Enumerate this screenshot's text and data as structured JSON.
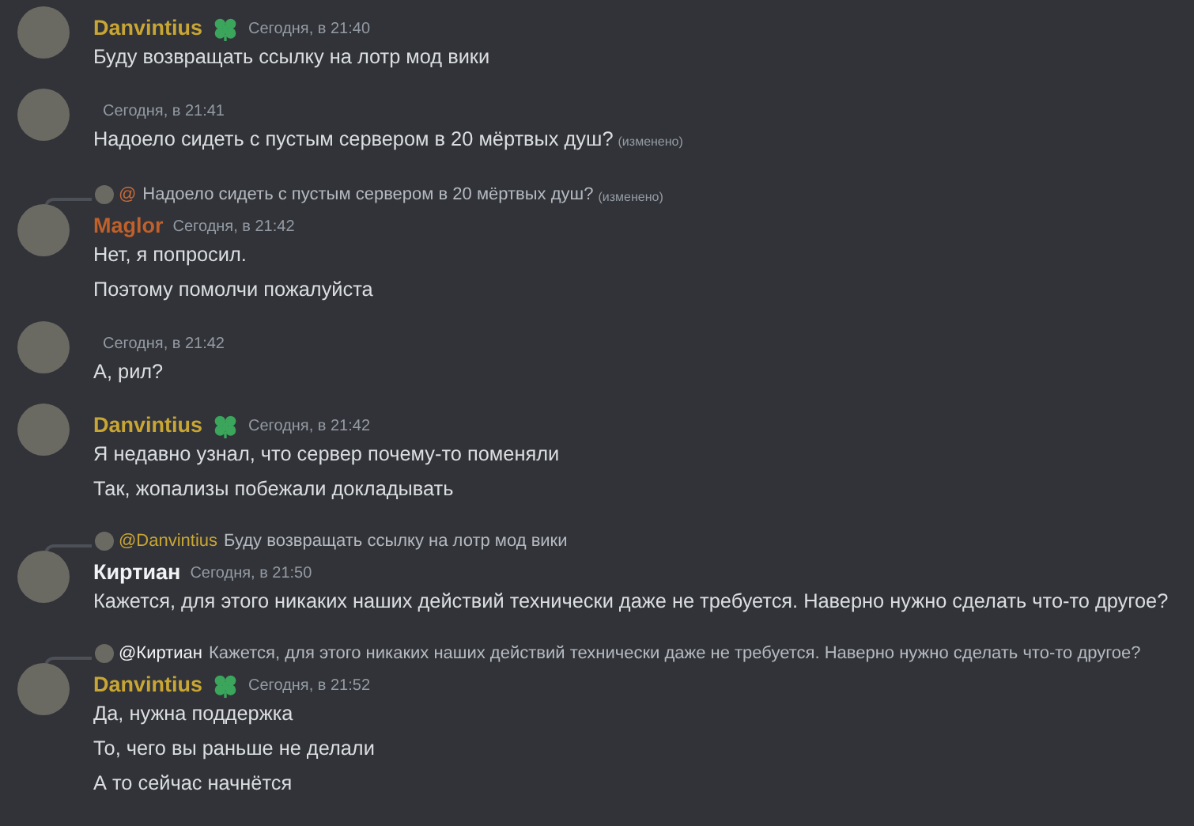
{
  "messages": [
    {
      "author": {
        "name": "Danvintius",
        "color": "#c9a634"
      },
      "badge": {
        "kind": "clover"
      },
      "time": "Сегодня, в 21:40",
      "lines": [
        {
          "text": "Буду возвращать ссылку на лотр мод вики"
        }
      ]
    },
    {
      "time": "Сегодня, в 21:41",
      "lines": [
        {
          "text": "Надоело сидеть с пустым сервером в 20 мёртвых душ?",
          "edited_note": "(изменено)"
        }
      ]
    },
    {
      "reply": {
        "mention": "@",
        "color": "#c76a3a",
        "text": "Надоело сидеть с пустым сервером в 20 мёртвых душ?",
        "edited_note": "(изменено)"
      },
      "author": {
        "name": "Maglor",
        "color": "#c0602a"
      },
      "time": "Сегодня, в 21:42",
      "lines": [
        {
          "text": "Нет, я попросил."
        },
        {
          "text": "Поэтому помолчи пожалуйста"
        }
      ]
    },
    {
      "time": "Сегодня, в 21:42",
      "lines": [
        {
          "text": "А, рил?"
        }
      ]
    },
    {
      "author": {
        "name": "Danvintius",
        "color": "#c9a634"
      },
      "badge": {
        "kind": "clover"
      },
      "time": "Сегодня, в 21:42",
      "lines": [
        {
          "text": "Я недавно узнал, что сервер почему-то поменяли"
        },
        {
          "text": "Так, жопализы побежали докладывать"
        }
      ]
    },
    {
      "reply": {
        "mention": "@Danvintius",
        "color": "#c9a634",
        "text": "Буду возвращать ссылку на лотр мод вики"
      },
      "author": {
        "name": "Киртиан",
        "color": "#f2f3f5"
      },
      "time": "Сегодня, в 21:50",
      "lines": [
        {
          "text": "Кажется, для этого никаких наших действий технически даже не требуется. Наверно нужно сделать что-то другое?"
        }
      ]
    },
    {
      "reply": {
        "mention": "@Киртиан",
        "color": "#f2f3f5",
        "text": "Кажется, для этого никаких наших действий технически даже не требуется. Наверно нужно сделать что-то другое?"
      },
      "author": {
        "name": "Danvintius",
        "color": "#c9a634"
      },
      "badge": {
        "kind": "clover"
      },
      "time": "Сегодня, в 21:52",
      "lines": [
        {
          "text": "Да, нужна поддержка"
        },
        {
          "text": "То, чего вы раньше не делали"
        },
        {
          "text": "А то сейчас начнётся"
        }
      ]
    }
  ]
}
